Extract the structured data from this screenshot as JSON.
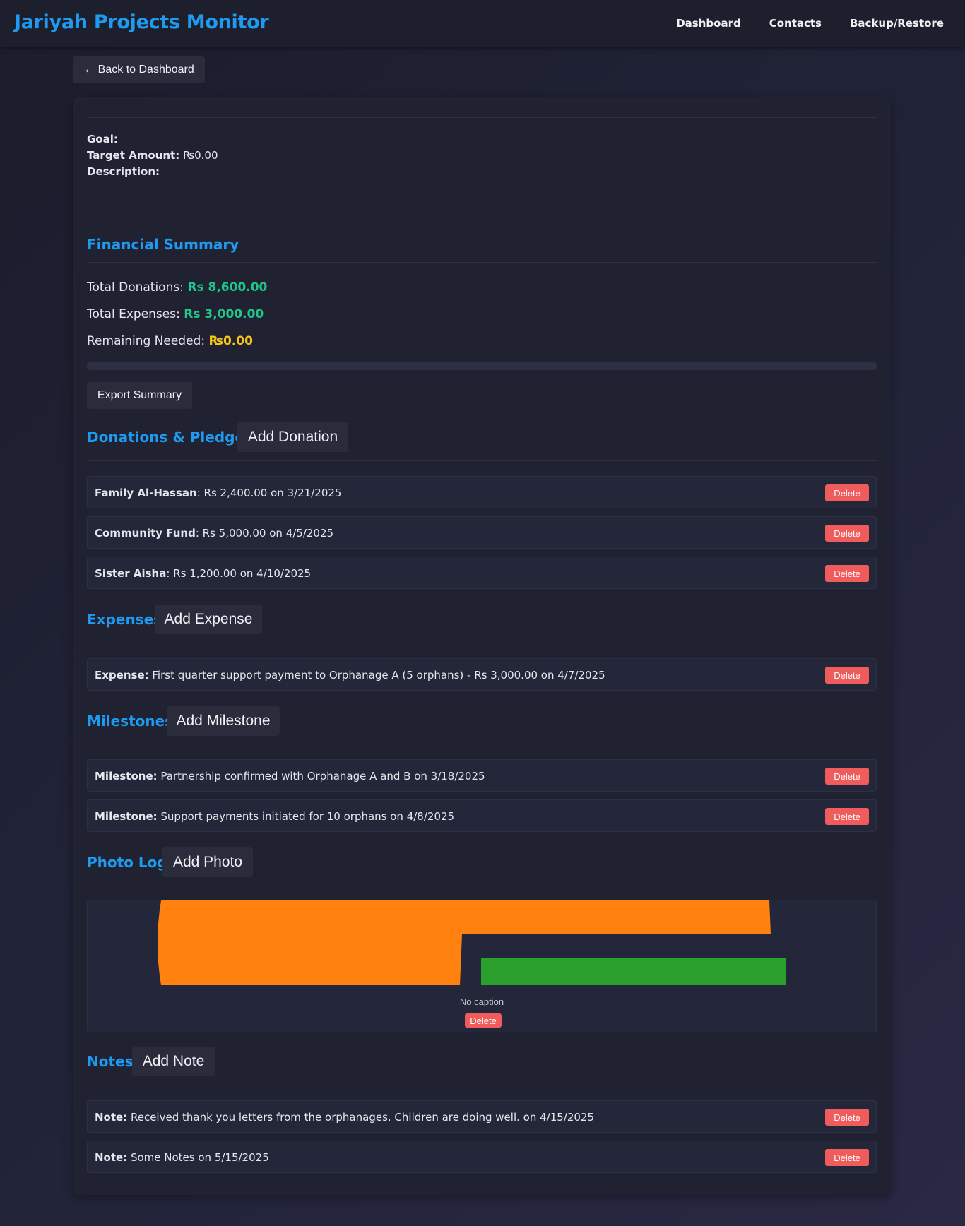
{
  "app": {
    "title": "Jariyah Projects Monitor",
    "nav": [
      "Dashboard",
      "Contacts",
      "Backup/Restore"
    ]
  },
  "back_button": "← Back to Dashboard",
  "project": {
    "goal_label": "Goal:",
    "goal_value": "",
    "target_label": "Target Amount:",
    "target_value": "₨0.00",
    "description_label": "Description:",
    "description_value": ""
  },
  "financial": {
    "heading": "Financial Summary",
    "donations_label": "Total Donations:",
    "donations_value": "Rs 8,600.00",
    "expenses_label": "Total Expenses:",
    "expenses_value": "Rs 3,000.00",
    "remaining_label": "Remaining Needed:",
    "remaining_value": "₨0.00",
    "progress_fraction": 0,
    "export_label": "Export Summary"
  },
  "donations": {
    "heading": "Donations & Pledges",
    "add_label": "Add Donation",
    "items": [
      {
        "name": "Family Al-Hassan",
        "detail": ": Rs 2,400.00 on 3/21/2025"
      },
      {
        "name": "Community Fund",
        "detail": ": Rs 5,000.00 on 4/5/2025"
      },
      {
        "name": "Sister Aisha",
        "detail": ": Rs 1,200.00 on 4/10/2025"
      }
    ]
  },
  "expenses": {
    "heading": "Expenses",
    "add_label": "Add Expense",
    "items": [
      {
        "label": "Expense:",
        "detail": " First quarter support payment to Orphanage A (5 orphans) - Rs 3,000.00 on 4/7/2025"
      }
    ]
  },
  "milestones": {
    "heading": "Milestones",
    "add_label": "Add Milestone",
    "items": [
      {
        "label": "Milestone:",
        "detail": " Partnership confirmed with Orphanage A and B on 3/18/2025"
      },
      {
        "label": "Milestone:",
        "detail": " Support payments initiated for 10 orphans on 4/8/2025"
      }
    ]
  },
  "photos": {
    "heading": "Photo Log",
    "add_label": "Add Photo",
    "items": [
      {
        "caption": "No caption"
      }
    ]
  },
  "notes": {
    "heading": "Notes",
    "add_label": "Add Note",
    "items": [
      {
        "label": "Note:",
        "detail": " Received thank you letters from the orphanages. Children are doing well. on 4/15/2025"
      },
      {
        "label": "Note:",
        "detail": " Some Notes on 5/15/2025"
      }
    ]
  },
  "delete_label": "Delete",
  "colors": {
    "accent": "#1e9bf0",
    "money_green": "#1ec78a",
    "warning_yellow": "#f5c518",
    "delete_red": "#f05c5c",
    "photo_orange": "#ff8210",
    "photo_green": "#2ca02c"
  }
}
